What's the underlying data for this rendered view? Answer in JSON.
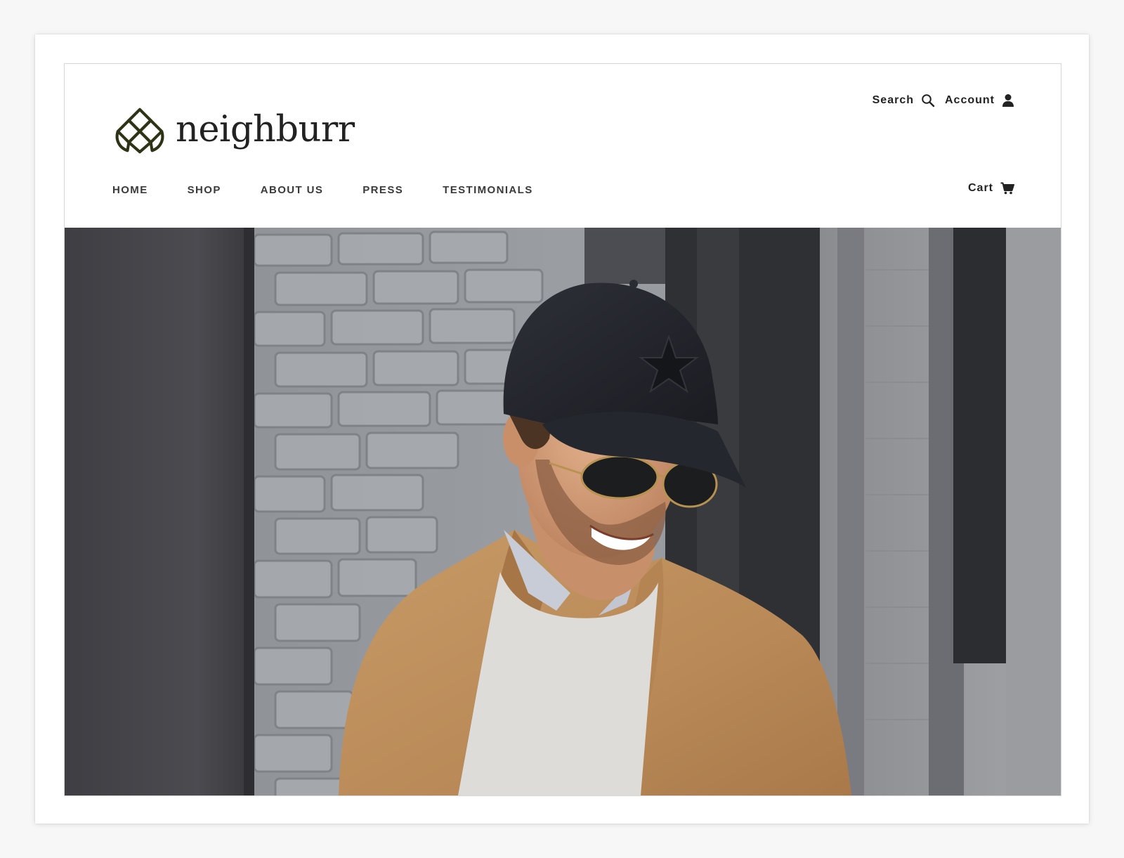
{
  "brand": {
    "name": "neighburr",
    "logo_color": "#2f3316"
  },
  "utility": {
    "search_label": "Search",
    "account_label": "Account"
  },
  "nav": {
    "items": [
      {
        "label": "HOME"
      },
      {
        "label": "SHOP"
      },
      {
        "label": "ABOUT US"
      },
      {
        "label": "PRESS"
      },
      {
        "label": "TESTIMONIALS"
      }
    ]
  },
  "cart": {
    "label": "Cart"
  },
  "hero": {
    "subject": "smiling man in black star cap, aviator sunglasses, camel blazer against grey brick wall"
  },
  "colors": {
    "text": "#222222",
    "nav_text": "#3a3a3a",
    "border": "#d6d6d6"
  }
}
